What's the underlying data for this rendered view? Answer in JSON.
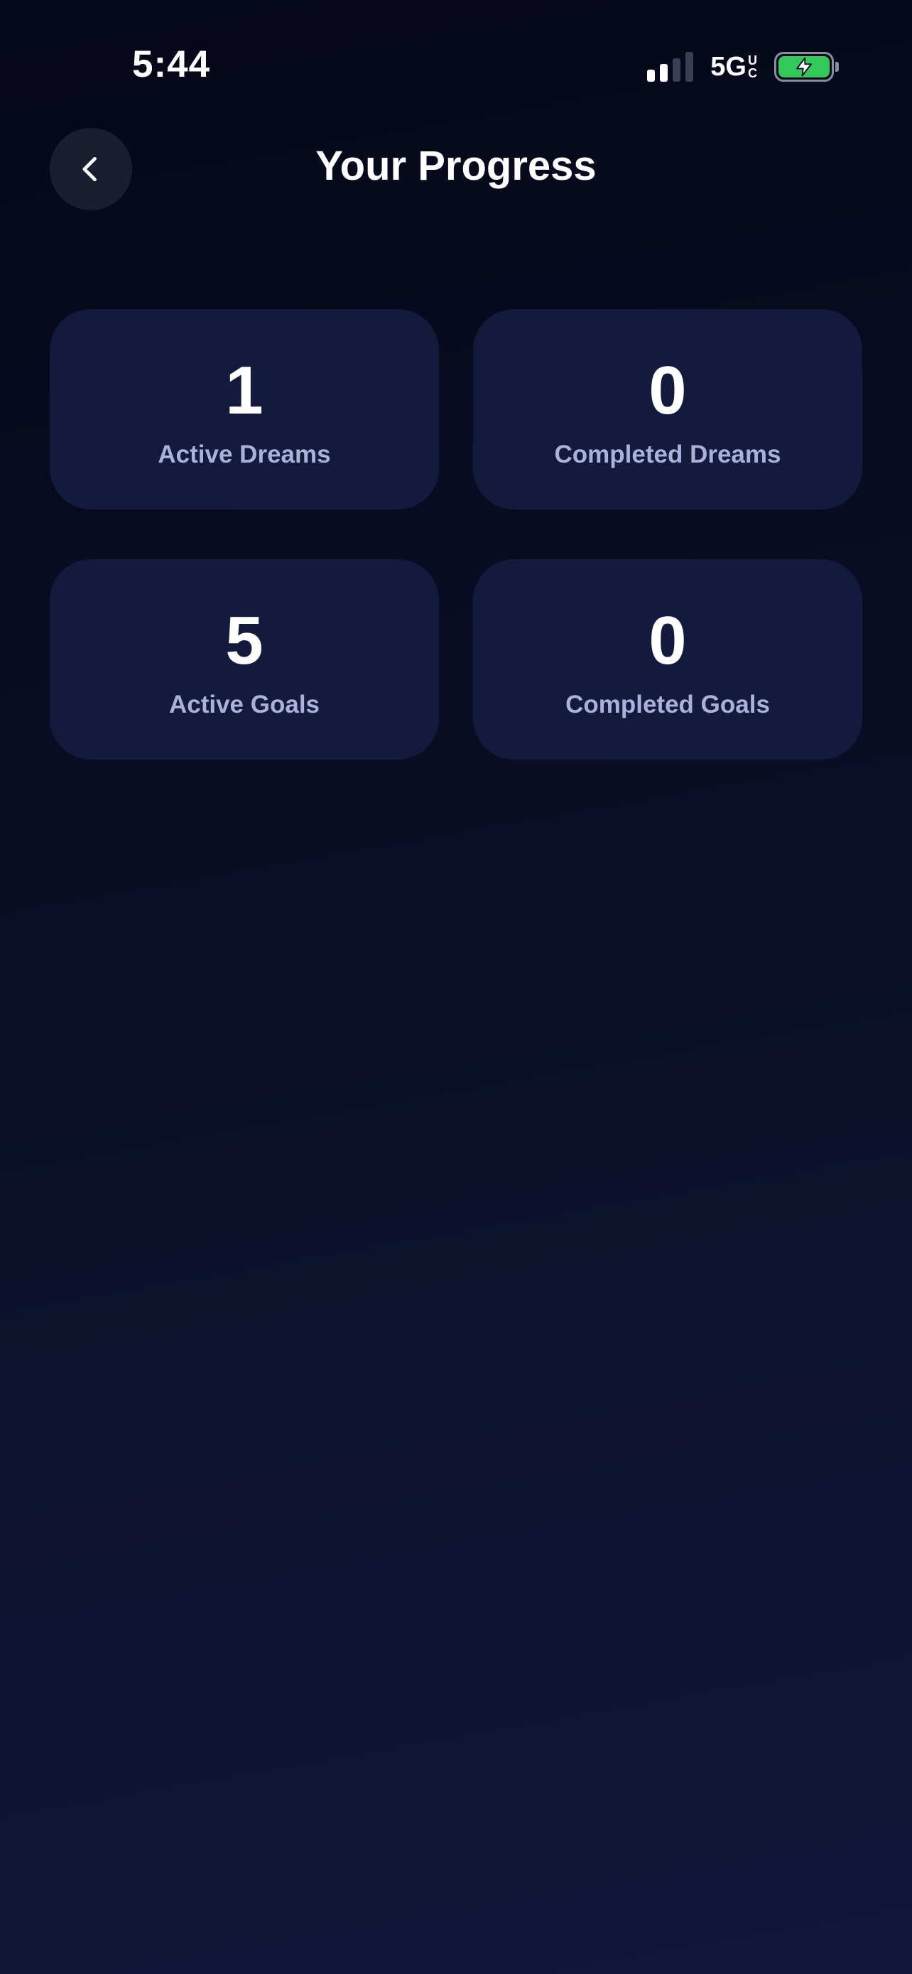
{
  "status_bar": {
    "time": "5:44",
    "network": "5G",
    "network_sup_top": "U",
    "network_sup_bottom": "C",
    "signal_bars_active": 2,
    "signal_bars_total": 4,
    "battery_charging": true,
    "battery_color": "#34c759"
  },
  "header": {
    "title": "Your Progress",
    "back_icon": "chevron-left-icon"
  },
  "stats": [
    {
      "value": "1",
      "label": "Active Dreams"
    },
    {
      "value": "0",
      "label": "Completed Dreams"
    },
    {
      "value": "5",
      "label": "Active Goals"
    },
    {
      "value": "0",
      "label": "Completed Goals"
    }
  ],
  "colors": {
    "background_top": "#050818",
    "background_bottom": "#111739",
    "card": "#131a3c",
    "label": "#a9b1dc"
  }
}
